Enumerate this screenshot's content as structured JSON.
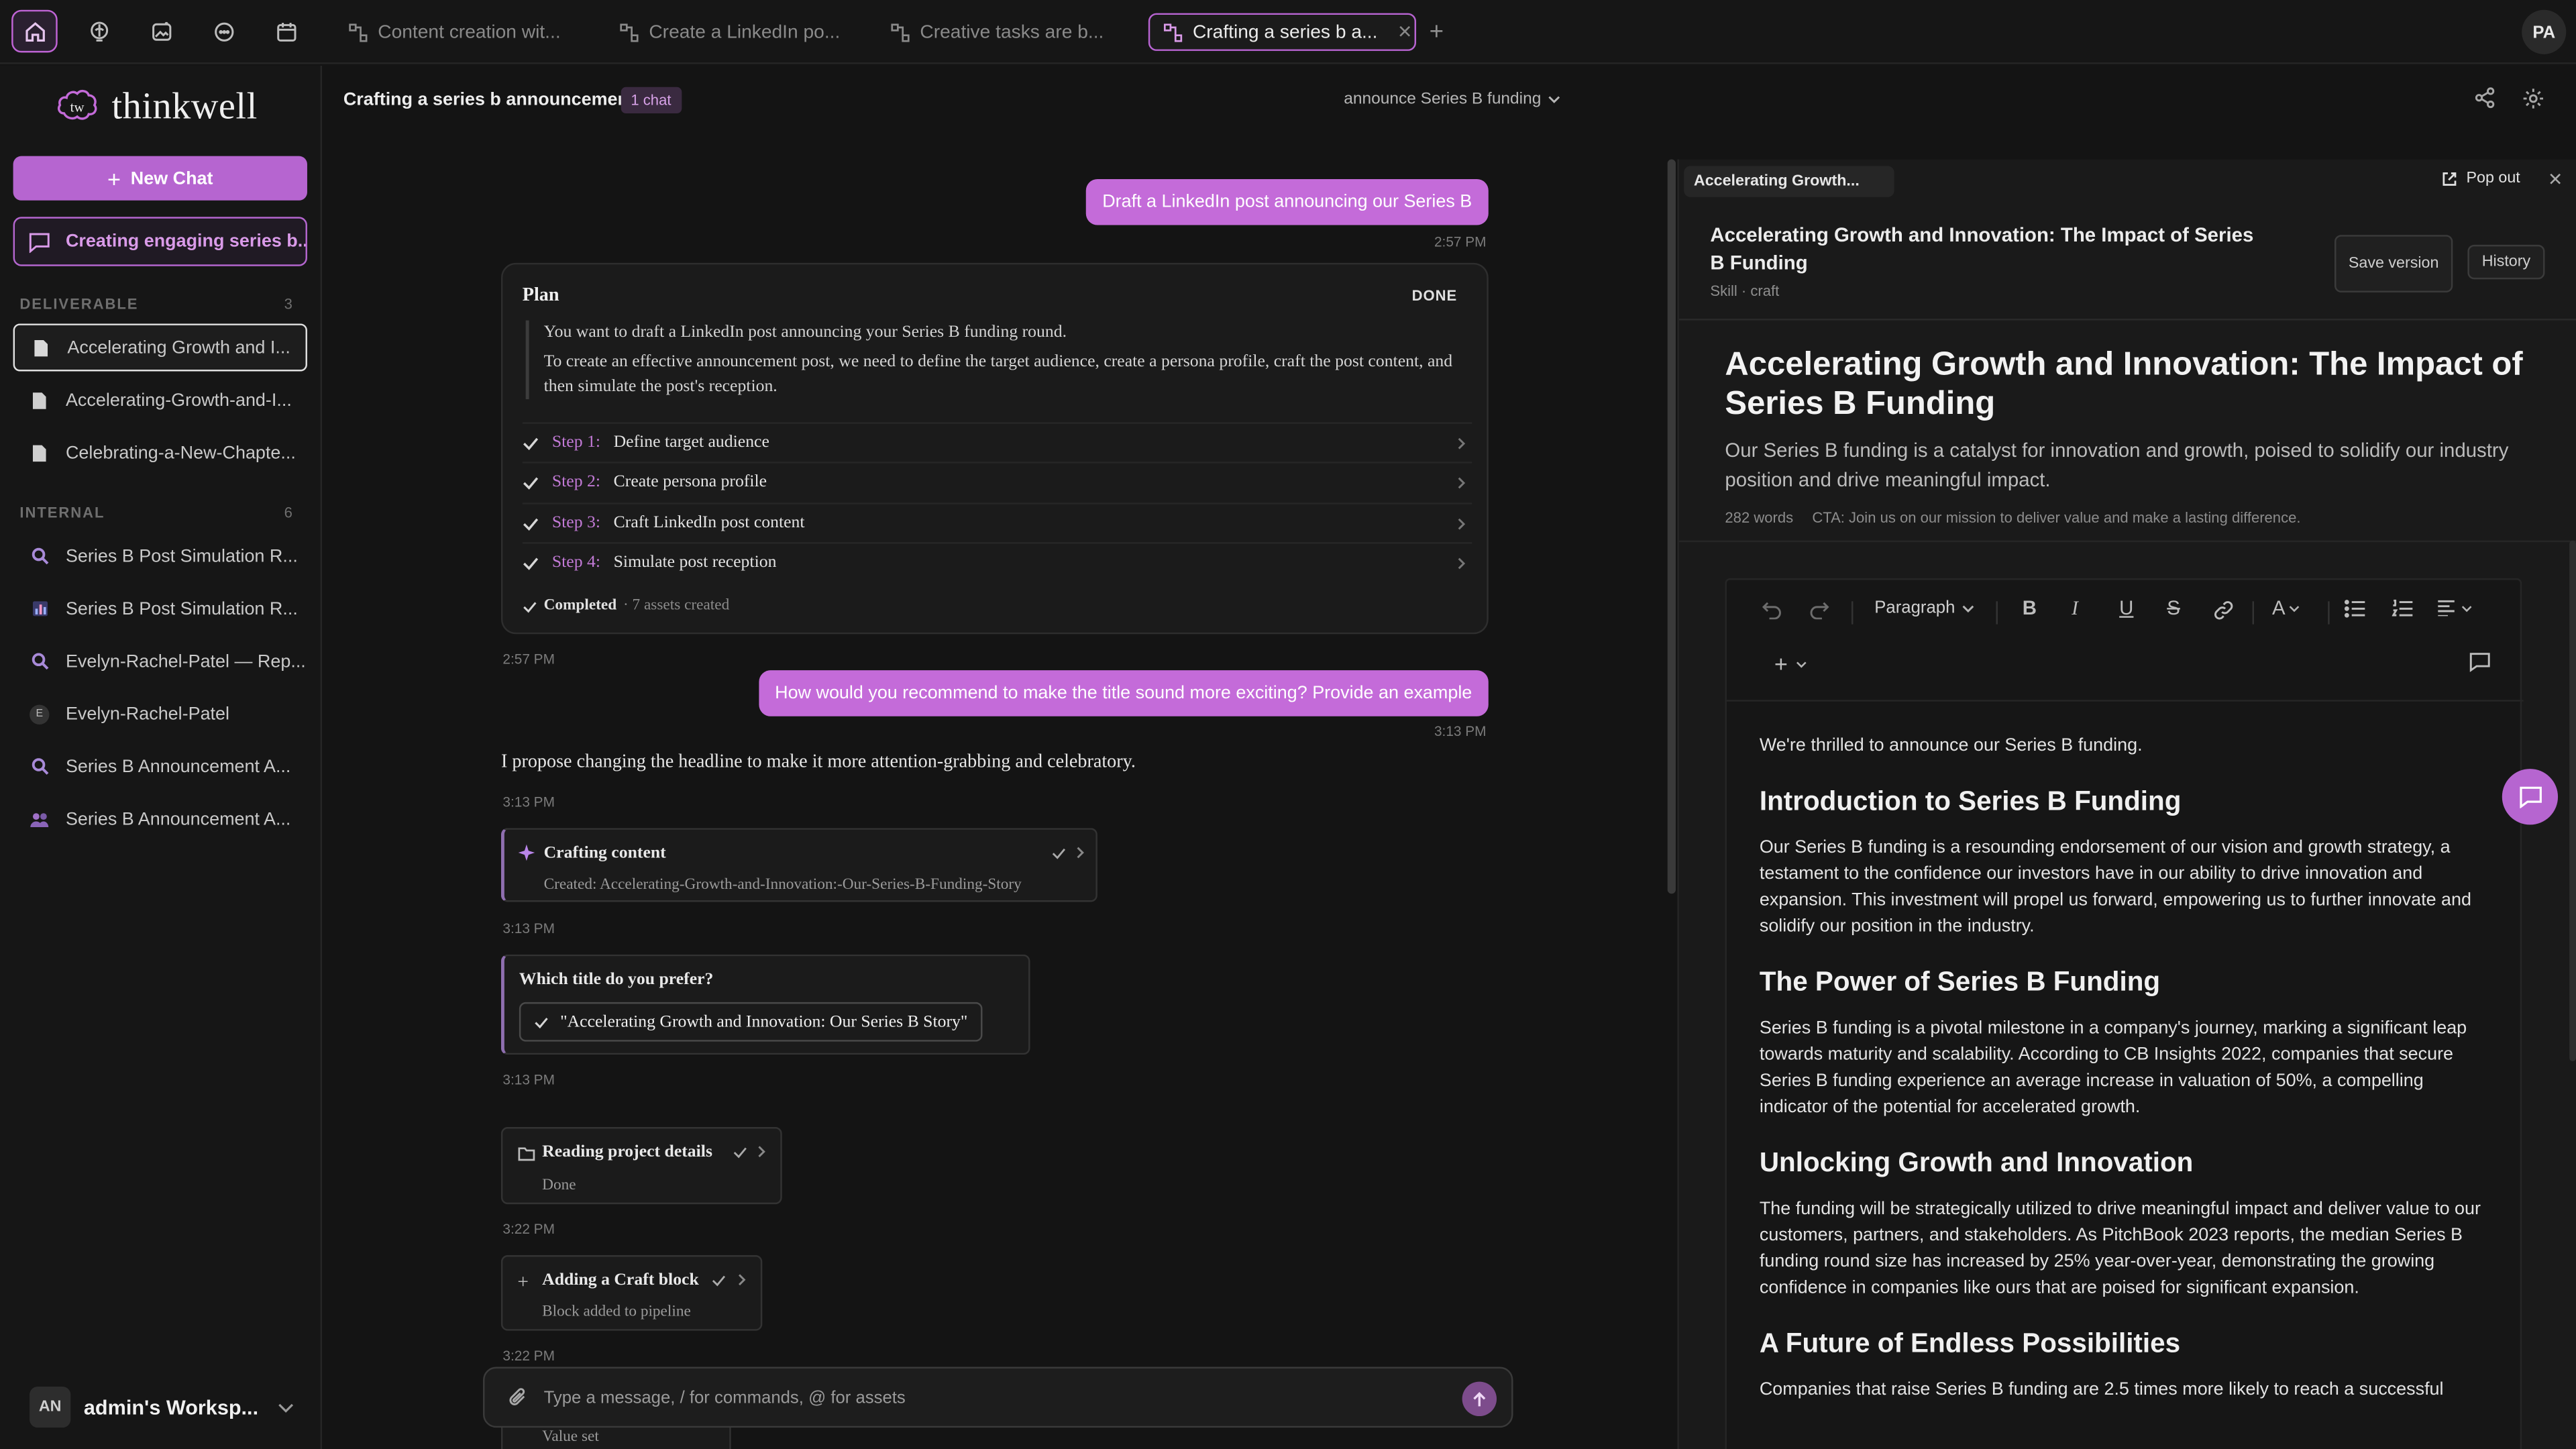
{
  "topbar": {
    "tabs": [
      {
        "label": "Content creation wit..."
      },
      {
        "label": "Create a LinkedIn po..."
      },
      {
        "label": "Creative tasks are b..."
      },
      {
        "label": "Crafting a series b a..."
      }
    ],
    "avatar": "PA"
  },
  "sidebar": {
    "brand": "thinkwell",
    "logo_mark": "tw",
    "new_chat": "New Chat",
    "active_chat": "Creating engaging series b...",
    "deliverable_label": "DELIVERABLE",
    "deliverable_count": "3",
    "deliverables": [
      {
        "label": "Accelerating Growth and I...",
        "icon": "document-icon"
      },
      {
        "label": "Accelerating-Growth-and-I...",
        "icon": "document-icon"
      },
      {
        "label": "Celebrating-a-New-Chapte...",
        "icon": "document-icon"
      }
    ],
    "internal_label": "INTERNAL",
    "internal_count": "6",
    "internal": [
      {
        "label": "Series B Post Simulation R...",
        "icon": "search-icon"
      },
      {
        "label": "Series B Post Simulation R...",
        "icon": "chart-icon"
      },
      {
        "label": "Evelyn-Rachel-Patel — Rep...",
        "icon": "search-icon"
      },
      {
        "label": "Evelyn-Rachel-Patel",
        "icon": "avatar-icon",
        "initial": "E"
      },
      {
        "label": "Series B Announcement A...",
        "icon": "search-icon"
      },
      {
        "label": "Series B Announcement A...",
        "icon": "people-icon"
      }
    ],
    "workspace_initials": "AN",
    "workspace_name": "admin's Worksp..."
  },
  "chat_header": {
    "title": "Crafting a series b announcement",
    "badge": "1 chat",
    "model": "announce Series B funding"
  },
  "chat": {
    "msg1": "Draft a LinkedIn post announcing our Series B",
    "msg1_time": "2:57 PM",
    "plan": {
      "title": "Plan",
      "status": "DONE",
      "intro1": "You want to draft a LinkedIn post announcing your Series B funding round.",
      "intro2": "To create an effective announcement post, we need to define the target audience, create a persona profile, craft the post content, and then simulate the post's reception.",
      "steps": [
        {
          "num": "Step 1:",
          "text": "Define target audience"
        },
        {
          "num": "Step 2:",
          "text": "Create persona profile"
        },
        {
          "num": "Step 3:",
          "text": "Craft LinkedIn post content"
        },
        {
          "num": "Step 4:",
          "text": "Simulate post reception"
        }
      ],
      "footer_status": "Completed",
      "footer_sub": "· 7 assets created"
    },
    "plan_time": "2:57 PM",
    "msg2": "How would you recommend to make the title sound more exciting? Provide an example",
    "msg2_time": "3:13 PM",
    "reply": "I propose changing the headline to make it more attention-grabbing and celebratory.",
    "reply_time": "3:13 PM",
    "crafting_title": "Crafting content",
    "crafting_sub": "Created: Accelerating-Growth-and-Innovation:-Our-Series-B-Funding-Story",
    "crafting_time": "3:13 PM",
    "choice_question": "Which title do you prefer?",
    "choice_option": "\"Accelerating Growth and Innovation: Our Series B Story\"",
    "choice_time": "3:13 PM",
    "reading_title": "Reading project details",
    "reading_sub": "Done",
    "reading_time": "3:22 PM",
    "adding_title": "Adding a Craft block",
    "adding_sub": "Block added to pipeline",
    "adding_time": "3:22 PM",
    "value_set": "Value set",
    "composer_placeholder": "Type a message, / for commands, @ for assets"
  },
  "doc": {
    "tab": "Accelerating Growth...",
    "popout": "Pop out",
    "head_title": "Accelerating Growth and Innovation: The Impact of Series B Funding",
    "head_sub": "Skill · craft",
    "save_version": "Save version",
    "history": "History",
    "title": "Accelerating Growth and Innovation: The Impact of Series B Funding",
    "description": "Our Series B funding is a catalyst for innovation and growth, poised to solidify our industry position and drive meaningful impact.",
    "words": "282 words",
    "cta": "CTA: Join us on our mission to deliver value and make a lasting difference.",
    "toolbar_style": "Paragraph",
    "body": {
      "p0": "We're thrilled to announce our Series B funding.",
      "h1": "Introduction to Series B Funding",
      "p1": "Our Series B funding is a resounding endorsement of our vision and growth strategy, a testament to the confidence our investors have in our ability to drive innovation and expansion. This investment will propel us forward, empowering us to further innovate and solidify our position in the industry.",
      "h2": "The Power of Series B Funding",
      "p2": "Series B funding is a pivotal milestone in a company's journey, marking a significant leap towards maturity and scalability. According to CB Insights 2022, companies that secure Series B funding experience an average increase in valuation of 50%, a compelling indicator of the potential for accelerated growth.",
      "h3": "Unlocking Growth and Innovation",
      "p3": "The funding will be strategically utilized to drive meaningful impact and deliver value to our customers, partners, and stakeholders. As PitchBook 2023 reports, the median Series B funding round size has increased by 25% year-over-year, demonstrating the growing confidence in companies like ours that are poised for significant expansion.",
      "h4": "A Future of Endless Possibilities",
      "p4": "Companies that raise Series B funding are 2.5 times more likely to reach a successful"
    }
  },
  "colors": {
    "accent": "#c46bd9",
    "background": "#141414",
    "panel": "#1b1b1b"
  }
}
